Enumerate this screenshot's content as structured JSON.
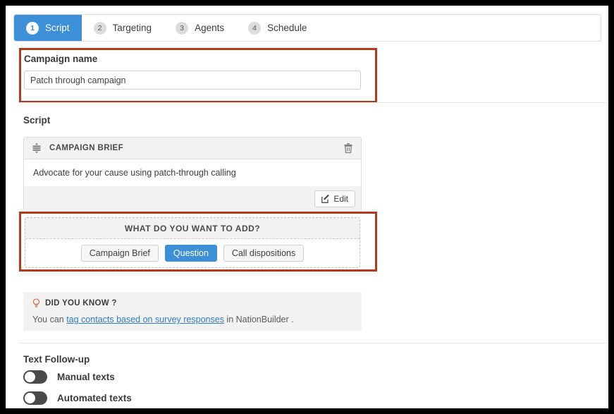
{
  "wizard": {
    "tabs": [
      {
        "num": "1",
        "label": "Script",
        "active": true
      },
      {
        "num": "2",
        "label": "Targeting",
        "active": false
      },
      {
        "num": "3",
        "label": "Agents",
        "active": false
      },
      {
        "num": "4",
        "label": "Schedule",
        "active": false
      }
    ]
  },
  "campaign": {
    "label": "Campaign name",
    "value": "Patch through campaign",
    "placeholder": "Campaign name"
  },
  "script": {
    "title": "Script",
    "brief_card": {
      "header": "CAMPAIGN BRIEF",
      "body": "Advocate for your cause using patch-through calling",
      "edit_label": "Edit",
      "drag_icon": "sort-handle-icon",
      "delete_icon": "trash-icon"
    },
    "add_panel": {
      "header": "WHAT DO YOU WANT TO ADD?",
      "buttons": [
        {
          "label": "Campaign Brief",
          "primary": false
        },
        {
          "label": "Question",
          "primary": true
        },
        {
          "label": "Call dispositions",
          "primary": false
        }
      ]
    },
    "did_you_know": {
      "icon": "lightbulb-icon",
      "header": "DID YOU KNOW ?",
      "text_before": "You can ",
      "link": "tag contacts based on survey responses",
      "text_after": " in NationBuilder ."
    }
  },
  "text_followup": {
    "title": "Text Follow-up",
    "toggles": [
      {
        "label": "Manual texts",
        "on": false
      },
      {
        "label": "Automated texts",
        "on": false
      }
    ]
  },
  "colors": {
    "accent_blue": "#3d8fd8",
    "annotation_red": "#b53a17",
    "toggle_off": "#4a4a4a",
    "link_blue": "#2f7cc4",
    "panel_gray": "#f2f2f2"
  }
}
